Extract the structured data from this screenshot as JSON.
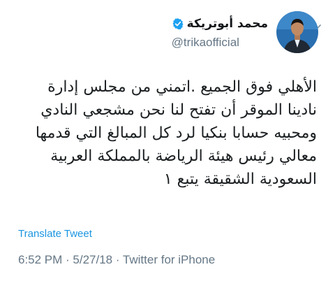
{
  "user": {
    "display_name": "محمد أبوتريكة",
    "handle": "@trikaofficial",
    "verified": true
  },
  "icons": {
    "verified": "verified-badge-icon",
    "menu": "chevron-down-icon"
  },
  "colors": {
    "verified_blue": "#1da1f2",
    "link_blue": "#1b95e0",
    "secondary_gray": "#657786",
    "text_dark": "#1c2022"
  },
  "tweet": {
    "lines": [
      "الأهلي فوق الجميع .اتمني من مجلس إدارة",
      "نادينا الموقر أن تفتح لنا نحن مشجعي النادي",
      "ومحبيه حسابا بنكيا لرد كل المبالغ التي قدمها",
      "معالي رئيس هيئة الرياضة بالمملكة العربية",
      "السعودية الشقيقة يتبع ١"
    ]
  },
  "translate_label": "Translate Tweet",
  "meta": "6:52 PM · 5/27/18 · Twitter for iPhone"
}
